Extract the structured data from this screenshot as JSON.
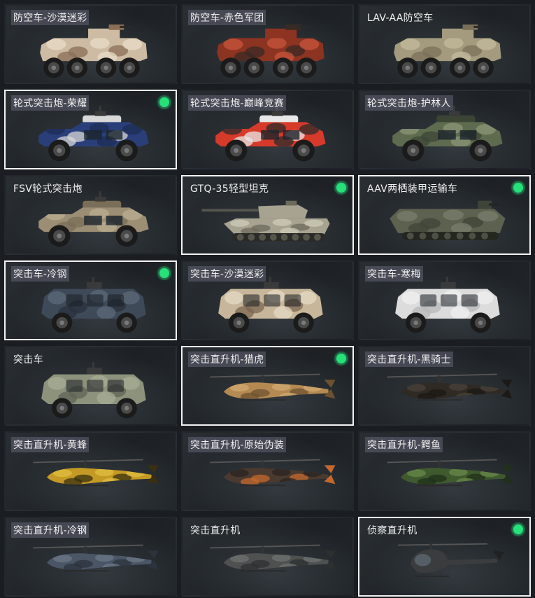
{
  "vehicles": [
    {
      "name": "防空车-沙漠迷彩",
      "type": "aa",
      "colors": [
        "#cdbca3",
        "#8a6e55",
        "#e8dcc8"
      ],
      "selected": false,
      "equipped": false,
      "label_tint": true
    },
    {
      "name": "防空车-赤色军团",
      "type": "aa",
      "colors": [
        "#8c3322",
        "#3a2a24",
        "#c8553c"
      ],
      "selected": false,
      "equipped": false,
      "label_tint": true
    },
    {
      "name": "LAV-AA防空车",
      "type": "aa",
      "colors": [
        "#a49a7e",
        "#7a705a",
        "#c4bb9e"
      ],
      "selected": false,
      "equipped": false,
      "label_tint": false
    },
    {
      "name": "轮式突击炮-荣耀",
      "type": "assault_gun",
      "colors": [
        "#2a3f7a",
        "#d8d8d8",
        "#1f2d55"
      ],
      "selected": true,
      "equipped": true,
      "label_tint": true
    },
    {
      "name": "轮式突击炮-巅峰竞赛",
      "type": "assault_gun",
      "colors": [
        "#d63a2a",
        "#e8e8e8",
        "#2b2b2b"
      ],
      "selected": false,
      "equipped": false,
      "label_tint": true
    },
    {
      "name": "轮式突击炮-护林人",
      "type": "assault_gun",
      "colors": [
        "#5f6b4e",
        "#3c4535",
        "#8b9478"
      ],
      "selected": false,
      "equipped": false,
      "label_tint": true
    },
    {
      "name": "FSV轮式突击炮",
      "type": "assault_gun",
      "colors": [
        "#9c8e74",
        "#7a6e58",
        "#b9ac90"
      ],
      "selected": false,
      "equipped": false,
      "label_tint": false
    },
    {
      "name": "GTQ-35轻型坦克",
      "type": "tank",
      "colors": [
        "#a8a391",
        "#6d6a5c",
        "#cfcbb9"
      ],
      "selected": true,
      "equipped": true,
      "label_tint": false
    },
    {
      "name": "AAV两栖装甲运输车",
      "type": "amphib",
      "colors": [
        "#5c6150",
        "#3f4438",
        "#7a7f6c"
      ],
      "selected": true,
      "equipped": true,
      "label_tint": false
    },
    {
      "name": "突击车-冷钢",
      "type": "assault_car",
      "colors": [
        "#3e4a58",
        "#2a323c",
        "#5c6a7a"
      ],
      "selected": true,
      "equipped": true,
      "label_tint": true
    },
    {
      "name": "突击车-沙漠迷彩",
      "type": "assault_car",
      "colors": [
        "#c7b69a",
        "#7c6650",
        "#e5d9c4"
      ],
      "selected": false,
      "equipped": false,
      "label_tint": true
    },
    {
      "name": "突击车-寒梅",
      "type": "assault_car",
      "colors": [
        "#dcdcdc",
        "#b8b8b8",
        "#f0f0f0"
      ],
      "selected": false,
      "equipped": false,
      "label_tint": true
    },
    {
      "name": "突击车",
      "type": "assault_car",
      "colors": [
        "#8d927c",
        "#5f6455",
        "#a8ad96"
      ],
      "selected": false,
      "equipped": false,
      "label_tint": false
    },
    {
      "name": "突击直升机-猎虎",
      "type": "heli",
      "colors": [
        "#b58a52",
        "#6d5232",
        "#d2a870"
      ],
      "selected": true,
      "equipped": true,
      "label_tint": true
    },
    {
      "name": "突击直升机-黑骑士",
      "type": "heli",
      "colors": [
        "#2f2a24",
        "#1c1916",
        "#4a4239"
      ],
      "selected": false,
      "equipped": false,
      "label_tint": true
    },
    {
      "name": "突击直升机-黄蜂",
      "type": "heli",
      "colors": [
        "#c49a25",
        "#3a3010",
        "#e0be40"
      ],
      "selected": false,
      "equipped": false,
      "label_tint": true
    },
    {
      "name": "突击直升机-原始伪装",
      "type": "heli",
      "colors": [
        "#4a3a30",
        "#c4682e",
        "#2c2420"
      ],
      "selected": false,
      "equipped": false,
      "label_tint": true
    },
    {
      "name": "突击直升机-鳄鱼",
      "type": "heli",
      "colors": [
        "#3f5a2e",
        "#22301a",
        "#6a8a4a"
      ],
      "selected": false,
      "equipped": false,
      "label_tint": true
    },
    {
      "name": "突击直升机-冷钢",
      "type": "heli",
      "colors": [
        "#4a5566",
        "#2c333d",
        "#6c7888"
      ],
      "selected": false,
      "equipped": false,
      "label_tint": true
    },
    {
      "name": "突击直升机",
      "type": "heli",
      "colors": [
        "#4e5150",
        "#2e3030",
        "#6e7270"
      ],
      "selected": false,
      "equipped": false,
      "label_tint": false
    },
    {
      "name": "侦察直升机",
      "type": "scout_heli",
      "colors": [
        "#3a3c3e",
        "#1f2122",
        "#5a5d60"
      ],
      "selected": true,
      "equipped": true,
      "label_tint": false
    }
  ]
}
